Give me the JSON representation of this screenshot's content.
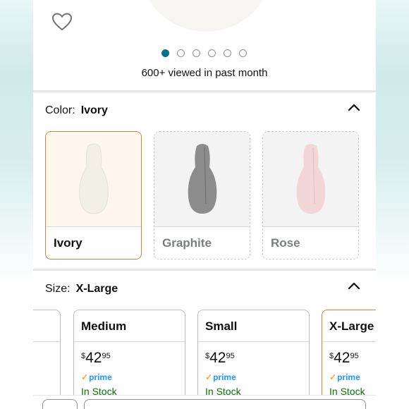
{
  "gallery": {
    "dot_count": 6,
    "active_index": 0,
    "viewed_text": "600+ viewed in past month"
  },
  "color_section": {
    "label": "Color:",
    "selected": "Ivory",
    "options": [
      {
        "name": "Ivory",
        "swatch_color": "#f1efe6",
        "state": "selected"
      },
      {
        "name": "Graphite",
        "swatch_color": "#8c8c8c",
        "state": "unavailable"
      },
      {
        "name": "Rose",
        "swatch_color": "#f2d6d8",
        "state": "unavailable"
      }
    ]
  },
  "size_section": {
    "label": "Size:",
    "selected": "X-Large",
    "options": [
      {
        "name": "Medium",
        "price_symbol": "$",
        "price_whole": "42",
        "price_fraction": "95",
        "prime": "prime",
        "stock": "In Stock"
      },
      {
        "name": "Small",
        "price_symbol": "$",
        "price_whole": "42",
        "price_fraction": "95",
        "prime": "prime",
        "stock": "In Stock"
      },
      {
        "name": "X-Large",
        "price_symbol": "$",
        "price_whole": "42",
        "price_fraction": "95",
        "prime": "prime",
        "stock": "In Stock"
      }
    ]
  },
  "colors": {
    "accent_selected_border": "#c7873a",
    "active_dot": "#00748c",
    "in_stock": "#007600",
    "prime_blue": "#1a98ff",
    "prime_check": "#f0a820"
  },
  "icons": {
    "favorite": "heart-outline-icon",
    "collapse": "chevron-up-icon"
  }
}
